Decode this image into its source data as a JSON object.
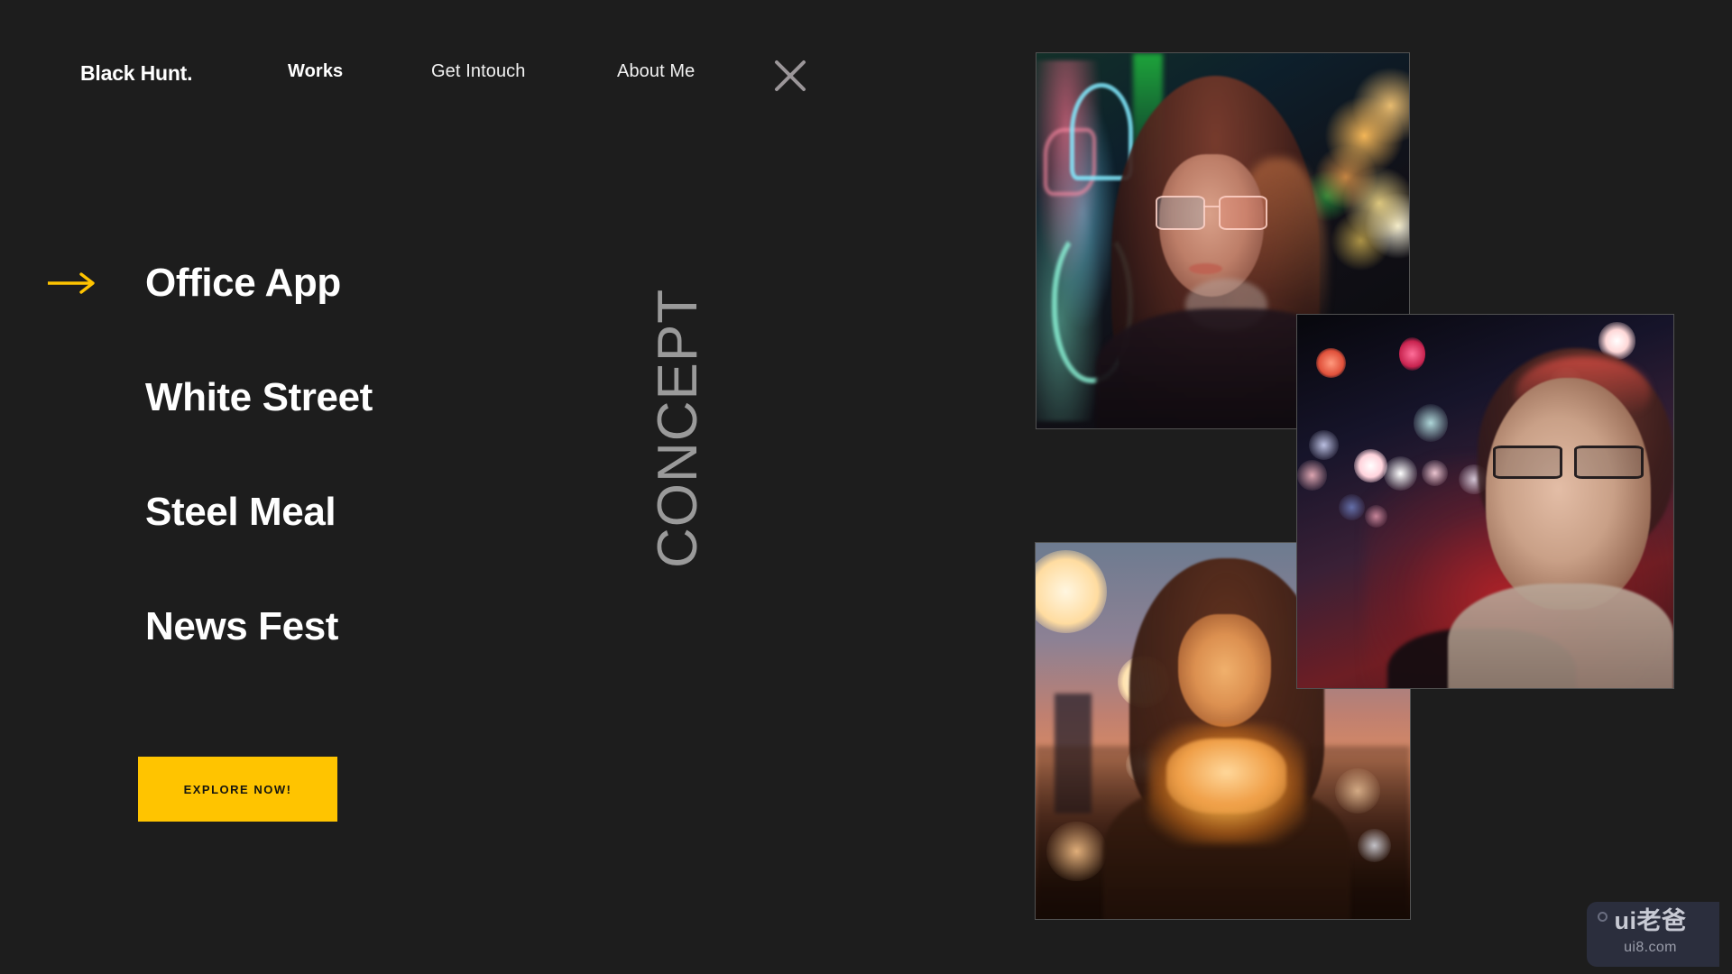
{
  "theme": {
    "background": "#1d1d1d",
    "accent": "#FFC400",
    "text_primary": "#ffffff",
    "text_muted": "#9a9a9a"
  },
  "header": {
    "brand": "Black Hunt.",
    "nav_items": [
      {
        "label": "Works",
        "active": true
      },
      {
        "label": "Get Intouch",
        "active": false
      },
      {
        "label": "About Me",
        "active": false
      }
    ],
    "close_icon": "close-icon"
  },
  "works": {
    "section_label": "CONCEPT",
    "items": [
      {
        "label": "Office App",
        "selected": true
      },
      {
        "label": "White Street",
        "selected": false
      },
      {
        "label": "Steel Meal",
        "selected": false
      },
      {
        "label": "News Fest",
        "selected": false
      }
    ],
    "arrow_icon": "arrow-right-icon"
  },
  "cta": {
    "label": "EXPLORE NOW!"
  },
  "gallery": {
    "photos": [
      {
        "alt": "Woman with glasses beside neon signs at night"
      },
      {
        "alt": "Woman with glasses looking up amid city bokeh lights"
      },
      {
        "alt": "Woman holding glowing string lights at sunset"
      }
    ]
  },
  "watermark": {
    "main": "ui老爸",
    "sub": "ui8.com"
  }
}
